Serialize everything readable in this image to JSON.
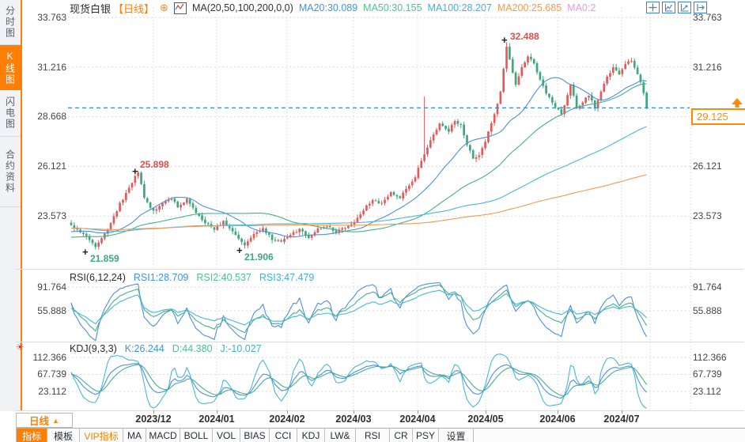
{
  "header": {
    "symbol": "现货白银",
    "timeframe_tag": "【日线】",
    "expand_icon": "⊕",
    "ma_formula": "MA(20,50,100,200,0,0)",
    "ma20": "MA20:30.089",
    "ma50": "MA50:30.155",
    "ma100": "MA100:28.207",
    "ma200": "MA200:25.685",
    "ma0": "MA0:2"
  },
  "sidebar": {
    "tabs": [
      {
        "label": "分时图"
      },
      {
        "label": "K线图",
        "active": true
      },
      {
        "label": "闪电图"
      },
      {
        "label": "合约资料"
      }
    ]
  },
  "axis": {
    "price_ticks": [
      "33.763",
      "31.216",
      "28.668",
      "26.121",
      "23.573"
    ],
    "rsi_ticks": [
      "91.764",
      "55.888"
    ],
    "kdj_ticks": [
      "112.366",
      "67.739",
      "23.112"
    ]
  },
  "price_marker": {
    "value": "29.125"
  },
  "annotations": {
    "top_high": "32.488",
    "dec_high": "25.898",
    "nov_low": "21.859",
    "feb_low": "21.906"
  },
  "rsi_panel": {
    "title": "RSI(6,12,24)",
    "rsi1": "RSI1:28.709",
    "rsi2": "RSI2:40.537",
    "rsi3": "RSI3:47.479"
  },
  "kdj_panel": {
    "title": "KDJ(9,3,3)",
    "k": "K:26.244",
    "d": "D:44.380",
    "j": "J:-10.027"
  },
  "xaxis": {
    "labels": [
      "2023/12",
      "2024/01",
      "2024/02",
      "2024/03",
      "2024/04",
      "2024/05",
      "2024/06",
      "2024/07"
    ]
  },
  "timeframe_button": {
    "label": "日线",
    "arrow": "▲"
  },
  "toolbar": {
    "items": [
      {
        "label": "指标",
        "active": true
      },
      {
        "label": "模板"
      },
      {
        "label": "VIP指标",
        "vip": true
      },
      {
        "label": "MA"
      },
      {
        "label": "MACD"
      },
      {
        "label": "BOLL"
      },
      {
        "label": "VOL"
      },
      {
        "label": "BIAS"
      },
      {
        "label": "CCI"
      },
      {
        "label": "KDJ"
      },
      {
        "label": "LW&"
      },
      {
        "label": "RSI"
      },
      {
        "label": "CR"
      },
      {
        "label": "PSY"
      },
      {
        "label": "设置"
      }
    ]
  },
  "chart_data": {
    "type": "candlestick",
    "symbol": "现货白银",
    "period": "日线",
    "title": "现货白银【日线】",
    "y_ticks": [
      33.763,
      31.216,
      28.668,
      26.121,
      23.573
    ],
    "x_labels": [
      "2023/12",
      "2024/01",
      "2024/02",
      "2024/03",
      "2024/04",
      "2024/05",
      "2024/06",
      "2024/07"
    ],
    "current_price": 29.125,
    "marked_points": {
      "high": 32.488,
      "december_high": 25.898,
      "november_low": 21.859,
      "february_low": 21.906
    },
    "ma_current": {
      "MA20": 30.089,
      "MA50": 30.155,
      "MA100": 28.207,
      "MA200": 25.685
    },
    "rsi_current": {
      "RSI1": 28.709,
      "RSI2": 40.537,
      "RSI3": 47.479
    },
    "rsi_axis": [
      91.764,
      55.888
    ],
    "kdj_current": {
      "K": 26.244,
      "D": 44.38,
      "J": -10.027
    },
    "kdj_axis": [
      112.366,
      67.739,
      23.112
    ],
    "n_candles": 190,
    "close_anchors": [
      [
        0,
        23.1
      ],
      [
        4,
        22.7
      ],
      [
        8,
        21.95
      ],
      [
        12,
        22.9
      ],
      [
        16,
        24.2
      ],
      [
        19,
        25.0
      ],
      [
        22,
        25.85
      ],
      [
        24,
        24.5
      ],
      [
        27,
        23.8
      ],
      [
        30,
        24.2
      ],
      [
        33,
        24.5
      ],
      [
        35,
        24.0
      ],
      [
        38,
        24.45
      ],
      [
        41,
        23.7
      ],
      [
        44,
        23.2
      ],
      [
        47,
        22.9
      ],
      [
        50,
        23.3
      ],
      [
        53,
        22.8
      ],
      [
        57,
        22.1
      ],
      [
        60,
        22.7
      ],
      [
        63,
        22.9
      ],
      [
        66,
        22.4
      ],
      [
        69,
        22.3
      ],
      [
        72,
        22.6
      ],
      [
        75,
        22.9
      ],
      [
        78,
        22.5
      ],
      [
        81,
        22.9
      ],
      [
        84,
        23.05
      ],
      [
        87,
        22.75
      ],
      [
        90,
        23.0
      ],
      [
        93,
        23.3
      ],
      [
        96,
        23.9
      ],
      [
        99,
        24.4
      ],
      [
        102,
        24.2
      ],
      [
        105,
        24.8
      ],
      [
        108,
        24.5
      ],
      [
        111,
        25.2
      ],
      [
        113,
        25.6
      ],
      [
        116,
        26.8
      ],
      [
        119,
        27.8
      ],
      [
        121,
        28.3
      ],
      [
        124,
        27.9
      ],
      [
        126,
        28.5
      ],
      [
        128,
        28.2
      ],
      [
        130,
        27.3
      ],
      [
        132,
        26.5
      ],
      [
        134,
        26.7
      ],
      [
        136,
        27.4
      ],
      [
        138,
        28.3
      ],
      [
        140,
        29.3
      ],
      [
        141,
        30.0
      ],
      [
        143,
        32.2
      ],
      [
        144,
        31.6
      ],
      [
        146,
        30.3
      ],
      [
        148,
        31.2
      ],
      [
        150,
        31.8
      ],
      [
        152,
        31.4
      ],
      [
        154,
        30.6
      ],
      [
        156,
        29.9
      ],
      [
        158,
        29.4
      ],
      [
        161,
        28.8
      ],
      [
        163,
        29.8
      ],
      [
        164,
        30.3
      ],
      [
        166,
        29.1
      ],
      [
        168,
        29.4
      ],
      [
        170,
        29.8
      ],
      [
        172,
        29.1
      ],
      [
        174,
        29.9
      ],
      [
        176,
        30.7
      ],
      [
        178,
        31.2
      ],
      [
        180,
        30.8
      ],
      [
        182,
        31.4
      ],
      [
        184,
        31.5
      ],
      [
        186,
        30.9
      ],
      [
        188,
        29.9
      ],
      [
        189,
        29.125
      ]
    ],
    "special_candles": {
      "8": {
        "low": 21.859
      },
      "22": {
        "high": 25.898
      },
      "57": {
        "low": 21.906
      },
      "116": {
        "high": 29.7
      },
      "143": {
        "high": 32.488
      },
      "189": {
        "close": 29.125
      }
    },
    "indicators": {
      "ma_periods": [
        20,
        50,
        100,
        200
      ],
      "rsi_periods": [
        6,
        12,
        24
      ],
      "kdj_params": [
        9,
        3,
        3
      ]
    },
    "colors": {
      "up_candle": "#e05c5c",
      "down_candle": "#3ea87d",
      "ma20": "#4f8fdc",
      "ma50": "#45b08c",
      "ma100": "#49b7d8",
      "ma200": "#f39a4f",
      "line1": "#4f8fdc",
      "line2": "#45b08c",
      "line3": "#49b7d8",
      "grid": "#dadada",
      "month_grid": "#cfcfcf",
      "price_line": "#2e8be6",
      "accent": "#ff7e05"
    }
  }
}
